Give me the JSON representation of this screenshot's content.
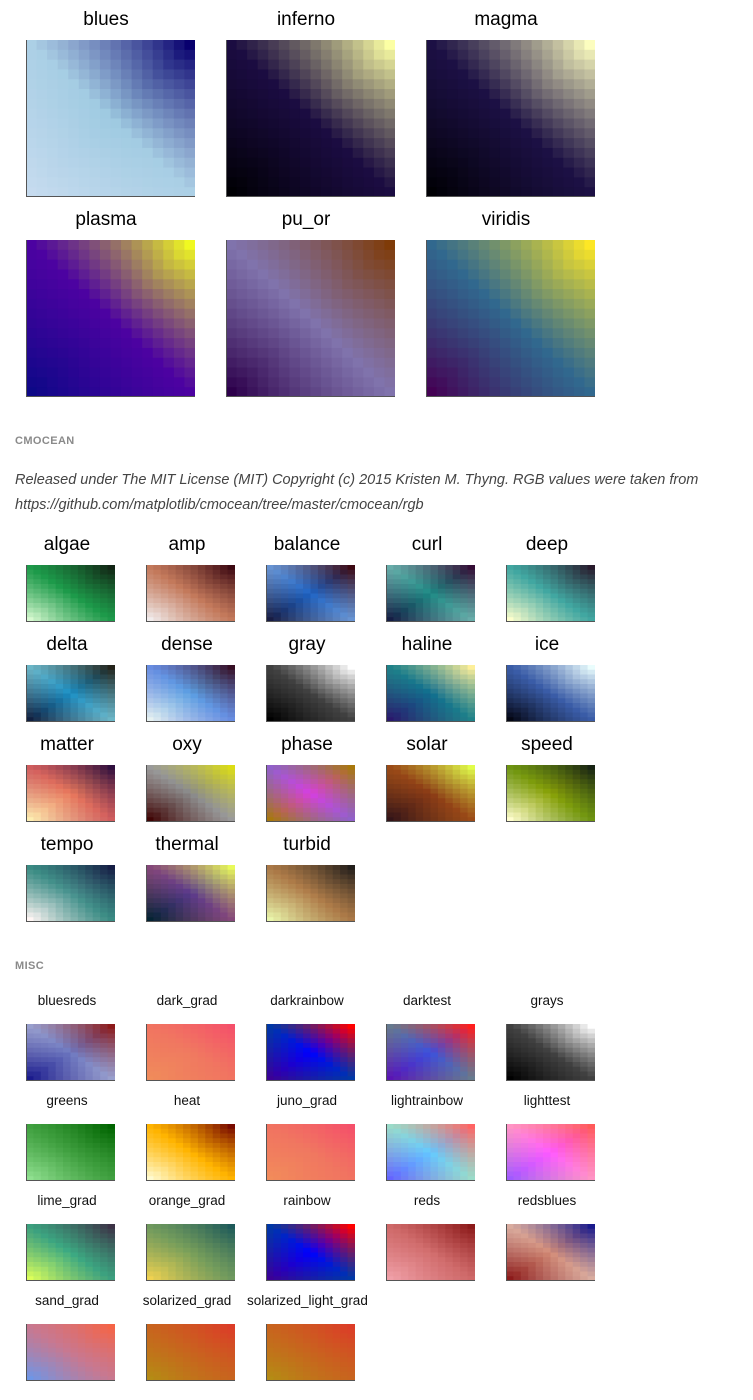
{
  "sections": {
    "top": {
      "maps": [
        {
          "name": "blues",
          "corners": [
            "#c6dbef",
            "#9ecae1",
            "#08006e",
            "#c6dbef"
          ]
        },
        {
          "name": "inferno",
          "corners": [
            "#000004",
            "#1b0c41",
            "#fcffa4",
            "#1b0c41"
          ]
        },
        {
          "name": "magma",
          "corners": [
            "#000004",
            "#1c1044",
            "#fcfdbf",
            "#1c1044"
          ]
        },
        {
          "name": "plasma",
          "corners": [
            "#0d0887",
            "#4c02a1",
            "#f0f921",
            "#4c02a1"
          ]
        },
        {
          "name": "pu_or",
          "corners": [
            "#2d004b",
            "#8073ac",
            "#7f3b08",
            "#8073ac"
          ]
        },
        {
          "name": "viridis",
          "corners": [
            "#440154",
            "#31688e",
            "#fde725",
            "#31688e"
          ]
        }
      ]
    },
    "cmocean": {
      "heading": "CMOCEAN",
      "description": "Released under The MIT License (MIT) Copyright (c) 2015 Kristen M. Thyng. RGB values were taken from https://github.com/matplotlib/cmocean/tree/master/cmocean/rgb",
      "maps": [
        {
          "name": "algae",
          "corners": [
            "#d7f9d0",
            "#1d9a4a",
            "#122414",
            "#1d9a4a"
          ]
        },
        {
          "name": "amp",
          "corners": [
            "#f1ecec",
            "#c3795b",
            "#3c0912",
            "#c3795b"
          ]
        },
        {
          "name": "balance",
          "corners": [
            "#181c43",
            "#1f64c4",
            "#3c0912",
            "#f0eeee"
          ]
        },
        {
          "name": "curl",
          "corners": [
            "#151d44",
            "#1e8a85",
            "#340d35",
            "#f0eeee"
          ]
        },
        {
          "name": "deep",
          "corners": [
            "#fdfecc",
            "#41a7a1",
            "#281a2c",
            "#41a7a1"
          ]
        },
        {
          "name": "delta",
          "corners": [
            "#112040",
            "#1c8fc4",
            "#23231a",
            "#fffdcd"
          ]
        },
        {
          "name": "dense",
          "corners": [
            "#e6f1f1",
            "#5c9fe2",
            "#360e24",
            "#7d6ce0"
          ]
        },
        {
          "name": "gray",
          "corners": [
            "#000000",
            "#404040",
            "#ffffff",
            "#404040"
          ]
        },
        {
          "name": "haline",
          "corners": [
            "#2a186c",
            "#116e8e",
            "#fdef9a",
            "#3aa681"
          ]
        },
        {
          "name": "ice",
          "corners": [
            "#040613",
            "#3a5ca7",
            "#eafdfd",
            "#3a5ca7"
          ]
        },
        {
          "name": "matter",
          "corners": [
            "#fdedb0",
            "#e8795d",
            "#2f0f3d",
            "#a42a5f"
          ]
        },
        {
          "name": "oxy",
          "corners": [
            "#400505",
            "#8a8a8a",
            "#dcdd14",
            "#b8b8b8"
          ]
        },
        {
          "name": "phase",
          "corners": [
            "#a8780d",
            "#d63fdf",
            "#a8780d",
            "#11a0a4"
          ]
        },
        {
          "name": "solar",
          "corners": [
            "#331418",
            "#8b3c16",
            "#e1fd4b",
            "#b8661a"
          ]
        },
        {
          "name": "speed",
          "corners": [
            "#fffdcd",
            "#8aa208",
            "#172313",
            "#3b7a23"
          ]
        },
        {
          "name": "tempo",
          "corners": [
            "#fff6f4",
            "#4a9490",
            "#151d44",
            "#1b7a6b"
          ]
        },
        {
          "name": "thermal",
          "corners": [
            "#042333",
            "#5a3a8b",
            "#e8fa5b",
            "#d6625b"
          ]
        },
        {
          "name": "turbid",
          "corners": [
            "#e9f6ab",
            "#b07d4a",
            "#221e1b",
            "#a07040"
          ]
        }
      ]
    },
    "misc": {
      "heading": "MISC",
      "maps": [
        {
          "name": "bluesreds",
          "corners": [
            "#1a1a8c",
            "#6e78c0",
            "#8c1a1a",
            "#e6e6e6"
          ]
        },
        {
          "name": "dark_grad",
          "corners": [
            "#f08c5a",
            "#f07a60",
            "#f5506a",
            "#f26a62"
          ]
        },
        {
          "name": "darkrainbow",
          "corners": [
            "#3c0096",
            "#0000ff",
            "#ff0000",
            "#00a000"
          ]
        },
        {
          "name": "darktest",
          "corners": [
            "#5a14b4",
            "#3c50dc",
            "#ff1e1e",
            "#b4c800"
          ]
        },
        {
          "name": "grays",
          "corners": [
            "#000000",
            "#404040",
            "#ffffff",
            "#404040"
          ]
        },
        {
          "name": "greens",
          "corners": [
            "#90e090",
            "#40a040",
            "#006400",
            "#40a040"
          ]
        },
        {
          "name": "heat",
          "corners": [
            "#fffbd0",
            "#ffb400",
            "#780a00",
            "#ffb400"
          ]
        },
        {
          "name": "juno_grad",
          "corners": [
            "#f28c5a",
            "#f07860",
            "#f5506a",
            "#f26a62"
          ]
        },
        {
          "name": "lightrainbow",
          "corners": [
            "#6464ff",
            "#64c8ff",
            "#ff6464",
            "#ffff64"
          ]
        },
        {
          "name": "lighttest",
          "corners": [
            "#a05aff",
            "#ff5aff",
            "#ff5a5a",
            "#ffff5a"
          ]
        },
        {
          "name": "lime_grad",
          "corners": [
            "#dcff5a",
            "#3caa82",
            "#3c3246",
            "#3c8c78"
          ]
        },
        {
          "name": "orange_grad",
          "corners": [
            "#f0d250",
            "#7aa05a",
            "#1e5a5a",
            "#5a8c64"
          ]
        },
        {
          "name": "rainbow",
          "corners": [
            "#3c0096",
            "#0000ff",
            "#ff0000",
            "#00a000"
          ]
        },
        {
          "name": "reds",
          "corners": [
            "#f0a0a8",
            "#d26e6e",
            "#8c1a1a",
            "#c86060"
          ]
        },
        {
          "name": "redsblues",
          "corners": [
            "#8c1a1a",
            "#d28c78",
            "#1a1a8c",
            "#e6e6e6"
          ]
        },
        {
          "name": "sand_grad",
          "corners": [
            "#6e96e6",
            "#c87890",
            "#f56446",
            "#c87890"
          ]
        },
        {
          "name": "solarized_grad",
          "corners": [
            "#b48c14",
            "#c8641e",
            "#dc3c28",
            "#c8641e"
          ]
        },
        {
          "name": "solarized_light_grad",
          "corners": [
            "#b48c14",
            "#c8641e",
            "#dc3c28",
            "#c8641e"
          ]
        }
      ]
    }
  }
}
